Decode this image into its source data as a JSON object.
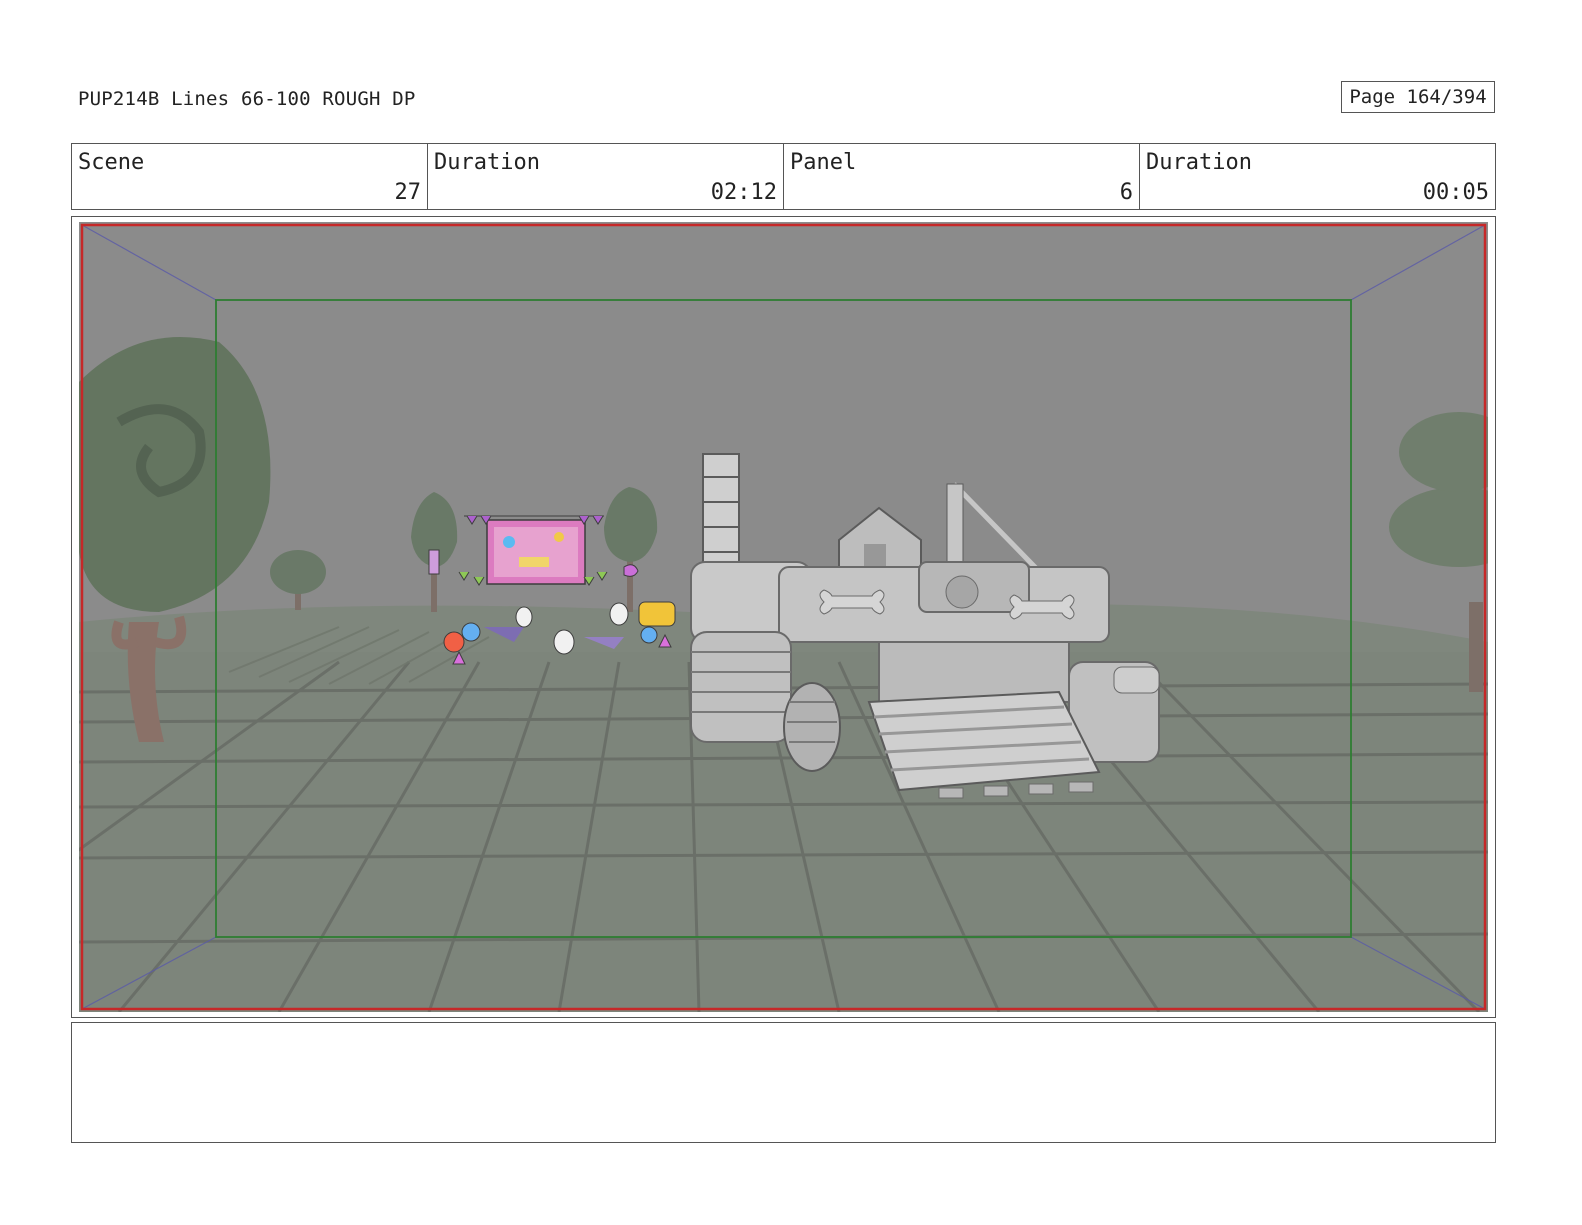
{
  "header": {
    "doc_title": "PUP214B Lines 66-100 ROUGH DP",
    "page_label": "Page 164/394"
  },
  "info": {
    "scene_label": "Scene",
    "scene_value": "27",
    "scene_duration_label": "Duration",
    "scene_duration_value": "02:12",
    "panel_label": "Panel",
    "panel_value": "6",
    "panel_duration_label": "Duration",
    "panel_duration_value": "00:05"
  },
  "colors": {
    "sky": "#8a8a8a",
    "ground": "#7f877c",
    "safe_frame": "#2e7d32",
    "outer_frame": "#c62828",
    "perspective_lines": "#5a5aa8"
  },
  "notes": ""
}
